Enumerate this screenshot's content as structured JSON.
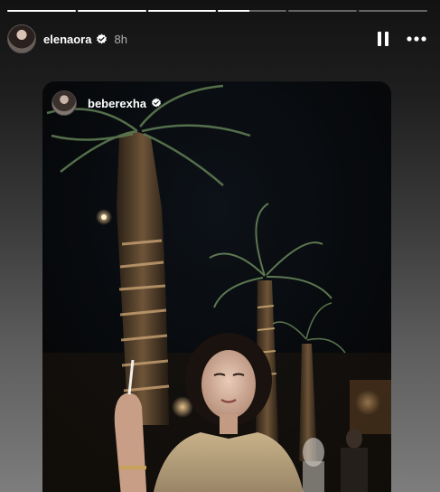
{
  "story": {
    "segments": [
      {
        "progress": 1.0
      },
      {
        "progress": 1.0
      },
      {
        "progress": 1.0
      },
      {
        "progress": 0.45
      },
      {
        "progress": 0.0
      },
      {
        "progress": 0.0
      }
    ]
  },
  "header": {
    "username": "elenaora",
    "verified_icon": "verified-badge-icon",
    "time": "8h",
    "pause_icon": "pause-icon",
    "more_icon": "more-options-icon"
  },
  "shared_post": {
    "username": "beberexha",
    "verified_icon": "verified-badge-icon"
  },
  "colors": {
    "accent": "#ffffff",
    "progress_track": "#5a5a5a"
  }
}
